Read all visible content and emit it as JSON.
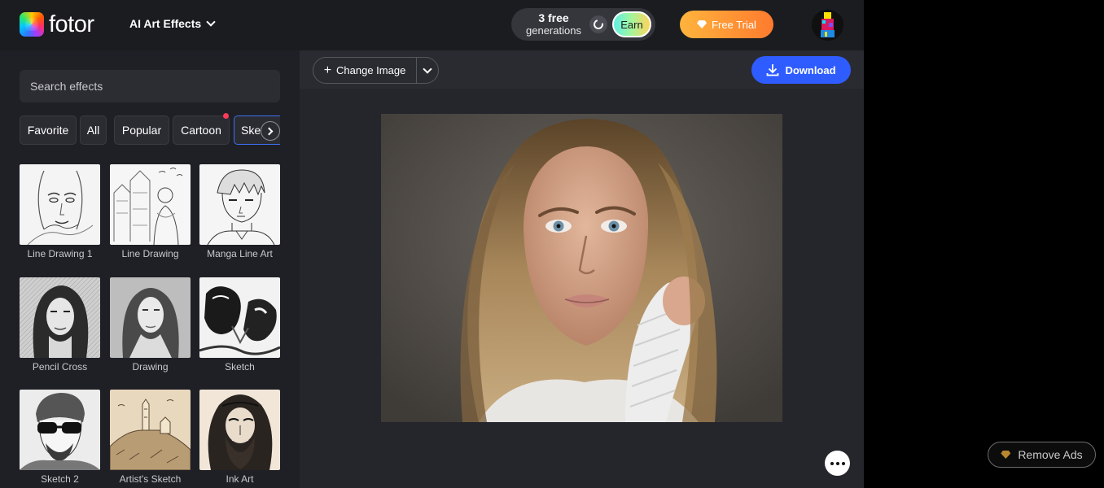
{
  "header": {
    "logo_text": "fotor",
    "menu_label": "AI Art Effects",
    "generations_count": "3 free",
    "generations_label": "generations",
    "earn_label": "Earn",
    "free_trial_label": "Free Trial"
  },
  "sidebar": {
    "search_placeholder": "Search effects",
    "tabs": [
      "Favorite",
      "All",
      "Popular",
      "Cartoon",
      "Sketch"
    ],
    "effects": [
      "Line Drawing 1",
      "Line Drawing",
      "Manga Line Art",
      "Pencil Cross",
      "Drawing",
      "Sketch",
      "Sketch 2",
      "Artist's Sketch",
      "Ink Art"
    ]
  },
  "toolbar": {
    "change_image_label": "Change Image",
    "download_label": "Download"
  },
  "ads": {
    "remove_ads_label": "Remove Ads"
  },
  "colors": {
    "accent_blue": "#2f5cff",
    "trial_orange": "#ff9a33",
    "notification_red": "#ff3b5c"
  }
}
